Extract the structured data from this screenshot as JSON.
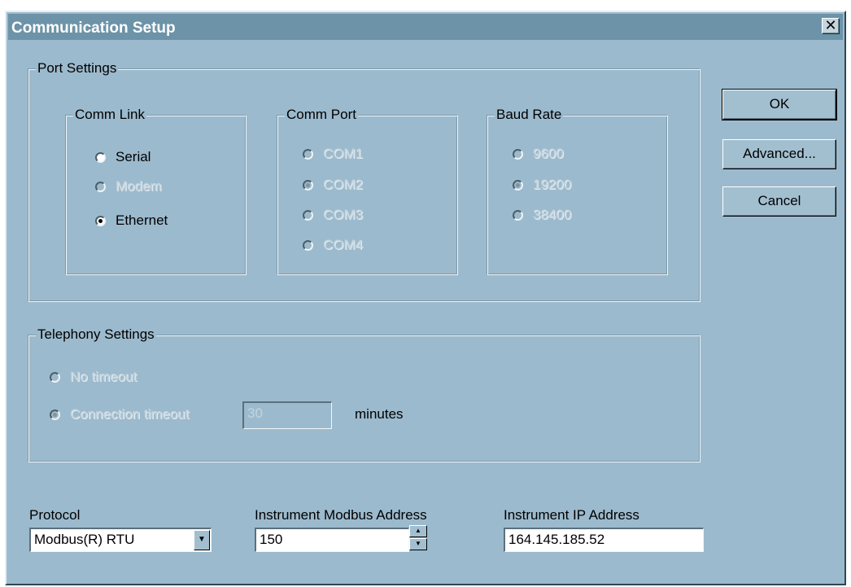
{
  "window": {
    "title": "Communication Setup",
    "close_icon": "close-icon",
    "close_glyph": "✕"
  },
  "port_settings": {
    "label": "Port Settings",
    "comm_link": {
      "label": "Comm Link",
      "options": [
        "Serial",
        "Modem",
        "Ethernet"
      ],
      "selected": "Ethernet"
    },
    "comm_port": {
      "label": "Comm Port",
      "options": [
        "COM1",
        "COM2",
        "COM3",
        "COM4"
      ],
      "selected": "COM2"
    },
    "baud_rate": {
      "label": "Baud Rate",
      "options": [
        "9600",
        "19200",
        "38400"
      ],
      "selected": "19200"
    }
  },
  "telephony": {
    "label": "Telephony Settings",
    "no_timeout": "No timeout",
    "connection_timeout": "Connection timeout",
    "timeout_value": "30",
    "timeout_unit": "minutes"
  },
  "protocol": {
    "label": "Protocol",
    "value": "Modbus(R) RTU"
  },
  "modbus_address": {
    "label": "Instrument Modbus Address",
    "value": "150"
  },
  "ip_address": {
    "label": "Instrument IP Address",
    "value": "164.145.185.52"
  },
  "buttons": {
    "ok": "OK",
    "advanced": "Advanced...",
    "cancel": "Cancel"
  },
  "colors": {
    "dialog_bg": "#9cbacd",
    "titlebar_bg": "#6c93a8"
  }
}
